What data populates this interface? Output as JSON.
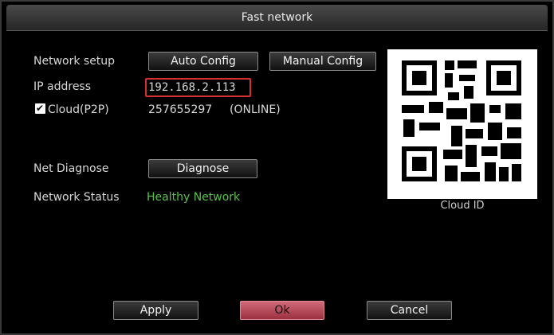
{
  "window": {
    "title": "Fast network"
  },
  "network_setup": {
    "label": "Network setup",
    "auto_label": "Auto Config",
    "manual_label": "Manual Config"
  },
  "ip": {
    "label": "IP address",
    "value": "192.168.2.113"
  },
  "cloud": {
    "label": "Cloud(P2P)",
    "checked": true,
    "id": "257655297",
    "status": "(ONLINE)"
  },
  "diagnose": {
    "label": "Net Diagnose",
    "button_label": "Diagnose"
  },
  "network_status": {
    "label": "Network Status",
    "value": "Healthy Network",
    "color": "#58c04a"
  },
  "qr": {
    "caption": "Cloud ID"
  },
  "footer": {
    "apply_label": "Apply",
    "ok_label": "Ok",
    "cancel_label": "Cancel"
  },
  "colors": {
    "ok_button": "#c05060",
    "highlight_border": "#d6302f"
  }
}
